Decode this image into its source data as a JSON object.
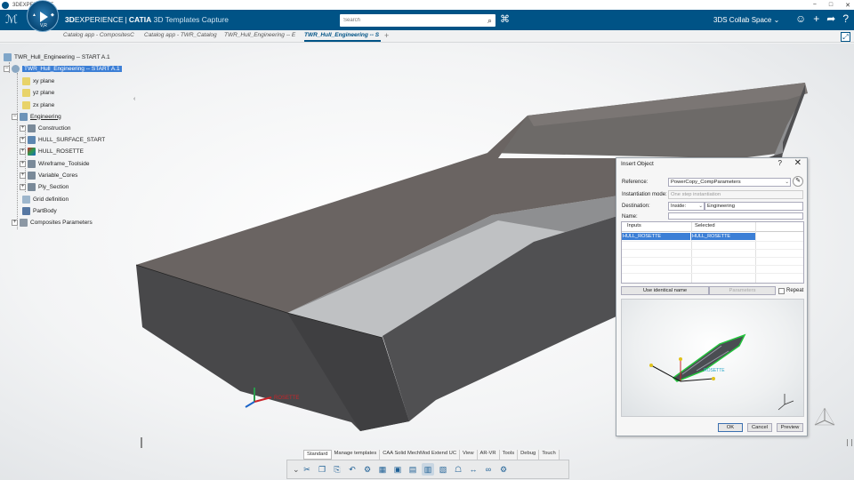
{
  "os": {
    "title": "3DEXPERIENCE",
    "controls": [
      "−",
      "□",
      "✕"
    ]
  },
  "header": {
    "brand_bold": "3D",
    "brand_rest": "EXPERIENCE",
    "app": "CATIA",
    "app_sub": "3D Templates Capture",
    "search_placeholder": "Search",
    "collab_space": "3DS Collab Space",
    "compass_version": "V,R"
  },
  "tabs": [
    "Catalog app - CompositesC",
    "Catalog app - TWR_Catalog",
    "TWR_Hull_Engineering -- E",
    "TWR_Hull_Engineering -- S"
  ],
  "tree": {
    "root": "TWR_Hull_Engineering -- START A.1",
    "selected": "TWR_Hull_Engineering -- START A.1",
    "planes": [
      "xy plane",
      "yz plane",
      "zx plane"
    ],
    "engineering": "Engineering",
    "engineering_children": [
      "Construction",
      "HULL_SURFACE_START",
      "HULL_ROSETTE",
      "Wireframe_Toolside",
      "Variable_Cores",
      "Ply_Section"
    ],
    "others": [
      "Grid definition",
      "PartBody",
      "Composites Parameters"
    ]
  },
  "dialog": {
    "title": "Insert Object",
    "help": "?",
    "close": "✕",
    "reference_label": "Reference:",
    "reference_value": "PowerCopy_CompParameters",
    "instantiation_label": "Instantiation mode:",
    "instantiation_value": "One step instantiation",
    "destination_label": "Destination:",
    "destination_mode": "Inside:",
    "destination_value": "Engineering",
    "name_label": "Name:",
    "name_value": "",
    "table_headers": [
      "Inputs",
      "Selected"
    ],
    "table_rows": [
      {
        "input": "HULL_ROSETTE",
        "selected": "HULL_ROSETTE"
      }
    ],
    "use_identical_name": "Use identical name",
    "parameters": "Parameters",
    "repeat_label": "Repeat",
    "ok": "OK",
    "cancel": "Cancel",
    "preview": "Preview",
    "preview_label": "ROSETTE"
  },
  "action_bar": {
    "tabs": [
      "Standard",
      "Manage templates",
      "CAA Solid MechMod Extend UC",
      "View",
      "AR-VR",
      "Tools",
      "Debug",
      "Touch"
    ],
    "active_tab": "Standard"
  },
  "colors": {
    "header_bg": "#005386",
    "selection": "#3c7fd6",
    "hull_dark": "#4b4b4d",
    "hull_top": "#6f6966"
  }
}
